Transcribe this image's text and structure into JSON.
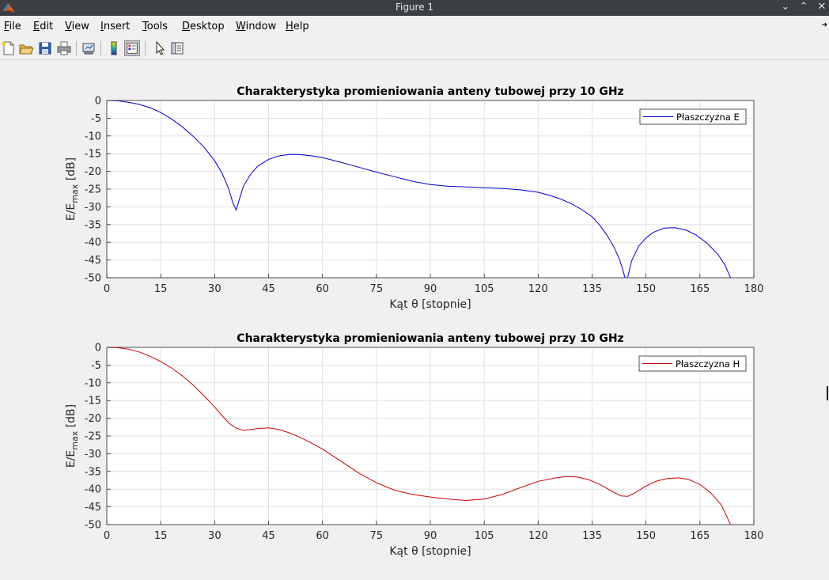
{
  "window": {
    "title": "Figure 1",
    "buttons": [
      "minimize-icon",
      "maximize-icon",
      "close-icon"
    ]
  },
  "menu": [
    {
      "pre": "",
      "u": "F",
      "post": "ile"
    },
    {
      "pre": "",
      "u": "E",
      "post": "dit"
    },
    {
      "pre": "",
      "u": "V",
      "post": "iew"
    },
    {
      "pre": "",
      "u": "I",
      "post": "nsert"
    },
    {
      "pre": "",
      "u": "T",
      "post": "ools"
    },
    {
      "pre": "",
      "u": "D",
      "post": "esktop"
    },
    {
      "pre": "",
      "u": "W",
      "post": "indow"
    },
    {
      "pre": "",
      "u": "H",
      "post": "elp"
    }
  ],
  "toolbar": [
    "new-figure-icon",
    "open-file-icon",
    "save-icon",
    "print-icon",
    "link-plot-icon",
    "colorbar-icon",
    "legend-icon",
    "edit-plot-icon",
    "property-inspector-icon"
  ],
  "colors": {
    "series1": "#0000cd",
    "series2": "#cc0000",
    "grid": "#dcdcdc",
    "axes_bg": "#ffffff"
  },
  "chart_data": [
    {
      "type": "line",
      "title": "Charakterystyka promieniowania anteny tubowej przy 10 GHz",
      "xlabel": "Kąt θ [stopnie]",
      "ylabel_main": "E/E",
      "ylabel_sub": "max",
      "ylabel_unit": " [dB]",
      "xlim": [
        0,
        180
      ],
      "ylim": [
        -50,
        0
      ],
      "xticks": [
        0,
        15,
        30,
        45,
        60,
        75,
        90,
        105,
        120,
        135,
        150,
        165,
        180
      ],
      "yticks": [
        0,
        -5,
        -10,
        -15,
        -20,
        -25,
        -30,
        -35,
        -40,
        -45,
        -50
      ],
      "grid": true,
      "legend_position": "top-right",
      "series": [
        {
          "name": "Płaszczyzna E",
          "color": "#0000cd",
          "x": [
            0,
            3,
            6,
            9,
            12,
            15,
            18,
            21,
            24,
            27,
            30,
            32,
            33,
            34,
            35,
            36,
            37,
            38,
            40,
            42,
            45,
            48,
            51,
            54,
            57,
            60,
            65,
            70,
            75,
            80,
            85,
            90,
            95,
            100,
            105,
            110,
            115,
            120,
            123,
            126,
            129,
            132,
            135,
            137,
            139,
            141,
            142.5,
            143.5,
            144,
            144.5,
            145,
            146,
            148,
            150,
            152,
            155,
            158,
            161,
            164,
            167,
            170,
            172,
            173.5
          ],
          "y": [
            0,
            -0.1,
            -0.5,
            -1.1,
            -2,
            -3.4,
            -5.2,
            -7.4,
            -10.1,
            -13.1,
            -17,
            -20.4,
            -22.7,
            -25.2,
            -28.7,
            -30.9,
            -27.5,
            -24.2,
            -20.8,
            -18.5,
            -16.6,
            -15.6,
            -15.2,
            -15.3,
            -15.6,
            -16.1,
            -17.4,
            -18.8,
            -20.2,
            -21.5,
            -22.8,
            -23.7,
            -24.2,
            -24.4,
            -24.6,
            -24.8,
            -25.2,
            -25.9,
            -26.7,
            -27.7,
            -29,
            -30.7,
            -32.8,
            -35,
            -37.8,
            -41.2,
            -44.5,
            -47.5,
            -49.5,
            -50.8,
            -49.5,
            -45.2,
            -41,
            -38.8,
            -37.2,
            -36,
            -35.9,
            -36.5,
            -38,
            -40.3,
            -43.4,
            -46.5,
            -50
          ]
        }
      ]
    },
    {
      "type": "line",
      "title": "Charakterystyka promieniowania anteny tubowej przy 10 GHz",
      "xlabel": "Kąt θ [stopnie]",
      "ylabel_main": "E/E",
      "ylabel_sub": "max",
      "ylabel_unit": " [dB]",
      "xlim": [
        0,
        180
      ],
      "ylim": [
        -50,
        0
      ],
      "xticks": [
        0,
        15,
        30,
        45,
        60,
        75,
        90,
        105,
        120,
        135,
        150,
        165,
        180
      ],
      "yticks": [
        0,
        -5,
        -10,
        -15,
        -20,
        -25,
        -30,
        -35,
        -40,
        -45,
        -50
      ],
      "grid": true,
      "legend_position": "top-right",
      "series": [
        {
          "name": "Płaszczyzna H",
          "color": "#cc0000",
          "x": [
            0,
            3,
            6,
            9,
            12,
            15,
            18,
            21,
            24,
            27,
            30,
            32,
            34,
            36,
            38,
            40,
            42,
            45,
            48,
            51,
            54,
            57,
            60,
            65,
            70,
            75,
            80,
            85,
            90,
            95,
            100,
            105,
            110,
            115,
            120,
            125,
            128,
            131,
            134,
            137,
            140,
            143,
            145,
            147,
            150,
            153,
            156,
            159,
            162,
            165,
            168,
            171,
            173.5
          ],
          "y": [
            0,
            -0.1,
            -0.5,
            -1.3,
            -2.5,
            -4,
            -5.8,
            -8,
            -10.6,
            -13.6,
            -16.8,
            -19.2,
            -21.4,
            -22.8,
            -23.4,
            -23.2,
            -22.9,
            -22.7,
            -23.2,
            -24.2,
            -25.5,
            -27,
            -28.7,
            -32,
            -35.4,
            -38.2,
            -40.3,
            -41.5,
            -42.2,
            -42.8,
            -43.2,
            -42.8,
            -41.5,
            -39.6,
            -37.8,
            -36.8,
            -36.4,
            -36.6,
            -37.3,
            -38.6,
            -40.3,
            -41.9,
            -42,
            -41,
            -39.1,
            -37.7,
            -37,
            -36.8,
            -37.3,
            -38.7,
            -41,
            -44.5,
            -50
          ]
        }
      ]
    }
  ]
}
